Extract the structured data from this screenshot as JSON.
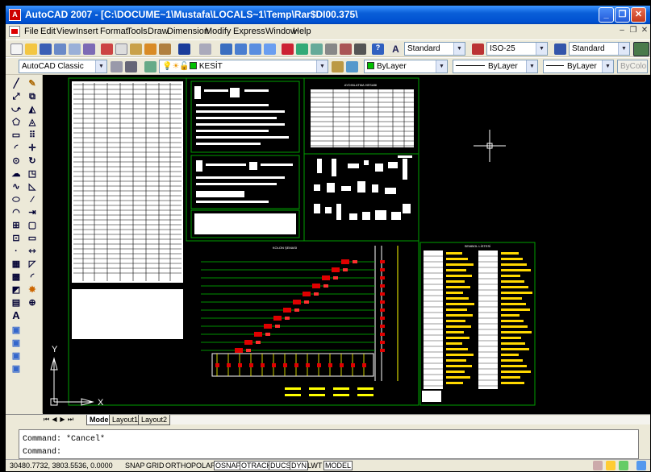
{
  "window": {
    "title": "AutoCAD 2007 - [C:\\DOCUME~1\\Mustafa\\LOCALS~1\\Temp\\Rar$DI00.375\\",
    "controls": [
      "_",
      "❐",
      "✕"
    ]
  },
  "menubar": {
    "items": [
      "File",
      "Edit",
      "View",
      "Insert",
      "Format",
      "Tools",
      "Draw",
      "Dimension",
      "Modify",
      "Express",
      "Window",
      "Help"
    ]
  },
  "toolbar1": {
    "text_style": "Standard",
    "dim_style": "ISO-25",
    "table_style": "Standard"
  },
  "toolbar2": {
    "workspace": "AutoCAD Classic",
    "layer": "KESİT",
    "color": "ByLayer",
    "linetype": "ByLayer",
    "lineweight": "ByLayer",
    "plot_style": "ByColor",
    "colors": {
      "color_swatch": "#00c000"
    }
  },
  "drawing": {
    "background": "#000000",
    "border_color": "#00a000",
    "sheet_titles": {
      "table": "AYDINLATMA HESABI",
      "riser": "KOLON ŞEMASI",
      "legend": "SEMBOL LİSTESİ"
    },
    "ucs": {
      "y": "Y",
      "x": "X"
    }
  },
  "layout_tabs": {
    "nav": [
      "⏮",
      "◀",
      "▶",
      "⏭"
    ],
    "tabs": [
      "Model",
      "Layout1",
      "Layout2"
    ],
    "active": "Model"
  },
  "command_line": {
    "lines": [
      "Command: *Cancel*",
      "Command:"
    ]
  },
  "status_bar": {
    "coordinates": "30480.7732, 3803.5536, 0.0000",
    "toggles": [
      "SNAP",
      "GRID",
      "ORTHO",
      "POLAR",
      "OSNAP",
      "OTRACK",
      "DUCS",
      "DYN",
      "LWT",
      "MODEL"
    ]
  }
}
